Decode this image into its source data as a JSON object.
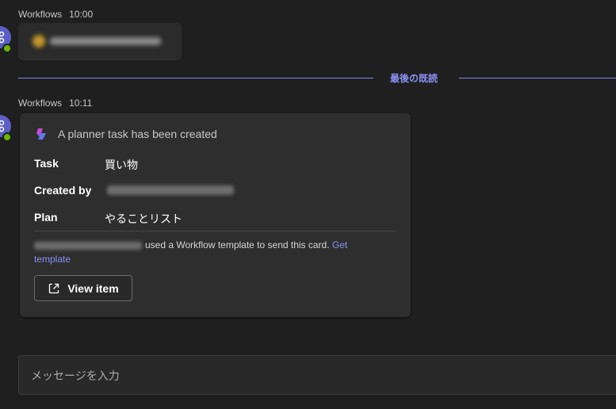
{
  "messages": [
    {
      "sender": "Workflows",
      "time": "10:00"
    },
    {
      "sender": "Workflows",
      "time": "10:11"
    }
  ],
  "divider": {
    "label": "最後の既読"
  },
  "card": {
    "title": "A planner task has been created",
    "facts": [
      {
        "key": "Task",
        "value": "買い物"
      },
      {
        "key": "Created by",
        "value": ""
      },
      {
        "key": "Plan",
        "value": "やることリスト"
      }
    ],
    "attribution_text": "used a Workflow template to send this card.",
    "attribution_link": "Get template",
    "view_button": "View item"
  },
  "composer": {
    "placeholder": "メッセージを入力"
  },
  "colors": {
    "background": "#1f1f1f",
    "card": "#2e2e2e",
    "accent": "#8b90f5",
    "avatar": "#5b5fc7",
    "presence": "#6bb700"
  },
  "icons": {
    "avatar": "workflows-icon",
    "presence": "available-status-icon",
    "planner": "planner-logo-icon",
    "open": "open-external-icon"
  }
}
